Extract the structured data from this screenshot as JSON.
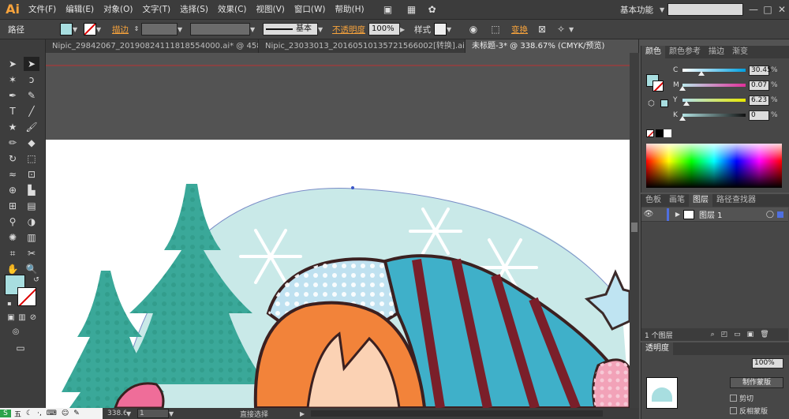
{
  "app": {
    "logo": "Ai"
  },
  "menu": [
    "文件(F)",
    "编辑(E)",
    "对象(O)",
    "文字(T)",
    "选择(S)",
    "效果(C)",
    "视图(V)",
    "窗口(W)",
    "帮助(H)"
  ],
  "workspace": "基本功能",
  "control": {
    "object_type": "路径",
    "stroke_label": "描边",
    "stroke_profile": "基本",
    "opacity_label": "不透明度",
    "opacity_value": "100%",
    "style_label": "样式",
    "transform_label": "变换"
  },
  "tabs": [
    {
      "label": "Nipic_29842067_20190824111818554000.ai* @ 458...",
      "active": false
    },
    {
      "label": "Nipic_23033013_20160510135721566002[转换].ai*",
      "active": false
    },
    {
      "label": "未标题-3* @ 338.67% (CMYK/预览)",
      "active": true
    }
  ],
  "panels": {
    "color_tabs": [
      "颜色",
      "颜色参考",
      "描边",
      "渐变"
    ],
    "cmyk": [
      {
        "ch": "C",
        "value": "30.45",
        "pos": 30.45
      },
      {
        "ch": "M",
        "value": "0.07",
        "pos": 0.07
      },
      {
        "ch": "Y",
        "value": "6.23",
        "pos": 6.23
      },
      {
        "ch": "K",
        "value": "0",
        "pos": 0
      }
    ],
    "percent": "%",
    "layer_tabs": [
      "色板",
      "画笔",
      "图层",
      "路径查找器"
    ],
    "layer_name": "图层 1",
    "layer_count": "1 个图层",
    "transparency_tab": "透明度",
    "transparency_value": "100%",
    "make_mask": "制作蒙版",
    "clip": "剪切",
    "invert_mask": "反相蒙版"
  },
  "status": {
    "zoom": "338.67%",
    "page": "1",
    "mode": "直接选择"
  },
  "colors": {
    "fill": "#a8dee0",
    "accent": "#f7a33c"
  },
  "ime": {
    "label": "五"
  }
}
